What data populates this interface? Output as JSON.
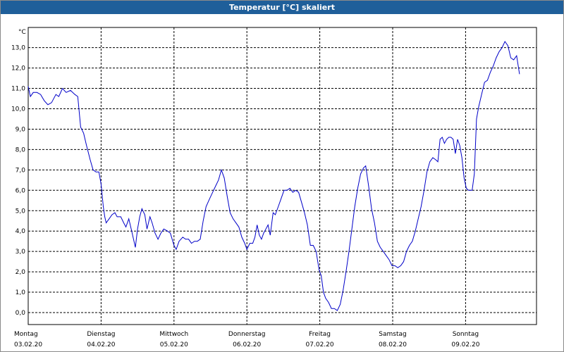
{
  "window": {
    "title": "Temperatur [°C] skaliert"
  },
  "colors": {
    "titlebar": "#1f5f9a",
    "series": "#0000c8",
    "grid": "#000000"
  },
  "chart_data": {
    "type": "line",
    "title": "Temperatur [°C] skaliert",
    "ylabel": "°C",
    "xlabel": "",
    "ylim": [
      -0.6,
      14.0
    ],
    "xlim": [
      0,
      7.0
    ],
    "grid": true,
    "legend": "none",
    "y_ticks": [
      "0,0",
      "1,0",
      "2,0",
      "3,0",
      "4,0",
      "5,0",
      "6,0",
      "7,0",
      "8,0",
      "9,0",
      "10,0",
      "11,0",
      "12,0",
      "13,0"
    ],
    "x_ticks": [
      {
        "day": "Montag",
        "date": "03.02.20"
      },
      {
        "day": "Dienstag",
        "date": "04.02.20"
      },
      {
        "day": "Mittwoch",
        "date": "05.02.20"
      },
      {
        "day": "Donnerstag",
        "date": "06.02.20"
      },
      {
        "day": "Freitag",
        "date": "07.02.20"
      },
      {
        "day": "Samstag",
        "date": "08.02.20"
      },
      {
        "day": "Sonntag",
        "date": "09.02.20"
      }
    ],
    "series": [
      {
        "points": [
          [
            0.0,
            11.1
          ],
          [
            0.03,
            10.6
          ],
          [
            0.07,
            10.8
          ],
          [
            0.12,
            10.8
          ],
          [
            0.17,
            10.7
          ],
          [
            0.22,
            10.4
          ],
          [
            0.27,
            10.2
          ],
          [
            0.32,
            10.3
          ],
          [
            0.38,
            10.7
          ],
          [
            0.42,
            10.6
          ],
          [
            0.47,
            11.0
          ],
          [
            0.52,
            10.8
          ],
          [
            0.58,
            10.9
          ],
          [
            0.64,
            10.7
          ],
          [
            0.68,
            10.6
          ],
          [
            0.72,
            9.1
          ],
          [
            0.76,
            8.8
          ],
          [
            0.8,
            8.2
          ],
          [
            0.85,
            7.5
          ],
          [
            0.89,
            7.0
          ],
          [
            0.93,
            6.9
          ],
          [
            0.97,
            6.9
          ],
          [
            1.0,
            6.3
          ],
          [
            1.03,
            5.2
          ],
          [
            1.05,
            4.7
          ],
          [
            1.07,
            4.4
          ],
          [
            1.11,
            4.6
          ],
          [
            1.15,
            4.8
          ],
          [
            1.19,
            4.9
          ],
          [
            1.22,
            4.7
          ],
          [
            1.27,
            4.7
          ],
          [
            1.31,
            4.4
          ],
          [
            1.34,
            4.2
          ],
          [
            1.38,
            4.6
          ],
          [
            1.42,
            4.0
          ],
          [
            1.47,
            3.2
          ],
          [
            1.5,
            4.1
          ],
          [
            1.53,
            4.7
          ],
          [
            1.56,
            5.1
          ],
          [
            1.6,
            4.8
          ],
          [
            1.63,
            4.1
          ],
          [
            1.67,
            4.7
          ],
          [
            1.7,
            4.4
          ],
          [
            1.74,
            3.9
          ],
          [
            1.78,
            3.6
          ],
          [
            1.82,
            3.9
          ],
          [
            1.86,
            4.1
          ],
          [
            1.91,
            4.0
          ],
          [
            1.95,
            3.9
          ],
          [
            2.0,
            3.3
          ],
          [
            2.03,
            3.1
          ],
          [
            2.07,
            3.5
          ],
          [
            2.12,
            3.7
          ],
          [
            2.16,
            3.6
          ],
          [
            2.2,
            3.6
          ],
          [
            2.24,
            3.4
          ],
          [
            2.28,
            3.5
          ],
          [
            2.32,
            3.5
          ],
          [
            2.36,
            3.6
          ],
          [
            2.4,
            4.5
          ],
          [
            2.44,
            5.2
          ],
          [
            2.49,
            5.6
          ],
          [
            2.53,
            5.9
          ],
          [
            2.57,
            6.2
          ],
          [
            2.61,
            6.5
          ],
          [
            2.65,
            7.0
          ],
          [
            2.69,
            6.6
          ],
          [
            2.73,
            5.7
          ],
          [
            2.77,
            4.9
          ],
          [
            2.81,
            4.6
          ],
          [
            2.85,
            4.4
          ],
          [
            2.89,
            4.2
          ],
          [
            2.93,
            3.7
          ],
          [
            2.97,
            3.4
          ],
          [
            3.0,
            3.1
          ],
          [
            3.04,
            3.4
          ],
          [
            3.08,
            3.4
          ],
          [
            3.11,
            3.7
          ],
          [
            3.14,
            4.3
          ],
          [
            3.17,
            3.8
          ],
          [
            3.2,
            3.6
          ],
          [
            3.23,
            3.9
          ],
          [
            3.26,
            4.1
          ],
          [
            3.29,
            4.3
          ],
          [
            3.32,
            3.8
          ],
          [
            3.36,
            4.9
          ],
          [
            3.39,
            4.8
          ],
          [
            3.43,
            5.2
          ],
          [
            3.47,
            5.6
          ],
          [
            3.51,
            6.0
          ],
          [
            3.55,
            6.0
          ],
          [
            3.59,
            6.1
          ],
          [
            3.63,
            5.9
          ],
          [
            3.67,
            6.0
          ],
          [
            3.71,
            5.9
          ],
          [
            3.75,
            5.4
          ],
          [
            3.79,
            4.9
          ],
          [
            3.83,
            4.3
          ],
          [
            3.87,
            3.3
          ],
          [
            3.91,
            3.3
          ],
          [
            3.95,
            3.0
          ],
          [
            3.99,
            2.1
          ],
          [
            4.02,
            1.8
          ],
          [
            4.05,
            1.0
          ],
          [
            4.08,
            0.7
          ],
          [
            4.12,
            0.5
          ],
          [
            4.16,
            0.2
          ],
          [
            4.2,
            0.2
          ],
          [
            4.24,
            0.1
          ],
          [
            4.28,
            0.4
          ],
          [
            4.32,
            1.1
          ],
          [
            4.36,
            2.0
          ],
          [
            4.4,
            3.0
          ],
          [
            4.44,
            4.1
          ],
          [
            4.48,
            5.2
          ],
          [
            4.52,
            6.1
          ],
          [
            4.56,
            6.8
          ],
          [
            4.6,
            7.1
          ],
          [
            4.63,
            7.2
          ],
          [
            4.67,
            6.2
          ],
          [
            4.71,
            5.1
          ],
          [
            4.75,
            4.4
          ],
          [
            4.79,
            3.5
          ],
          [
            4.83,
            3.2
          ],
          [
            4.87,
            3.0
          ],
          [
            4.91,
            2.8
          ],
          [
            4.95,
            2.6
          ],
          [
            4.99,
            2.3
          ],
          [
            5.03,
            2.3
          ],
          [
            5.07,
            2.2
          ],
          [
            5.11,
            2.3
          ],
          [
            5.15,
            2.5
          ],
          [
            5.19,
            3.0
          ],
          [
            5.23,
            3.3
          ],
          [
            5.27,
            3.5
          ],
          [
            5.31,
            4.0
          ],
          [
            5.35,
            4.6
          ],
          [
            5.39,
            5.2
          ],
          [
            5.43,
            6.0
          ],
          [
            5.47,
            6.9
          ],
          [
            5.51,
            7.4
          ],
          [
            5.55,
            7.6
          ],
          [
            5.59,
            7.5
          ],
          [
            5.62,
            7.4
          ],
          [
            5.65,
            8.5
          ],
          [
            5.68,
            8.6
          ],
          [
            5.71,
            8.3
          ],
          [
            5.74,
            8.5
          ],
          [
            5.77,
            8.6
          ],
          [
            5.8,
            8.6
          ],
          [
            5.83,
            8.5
          ],
          [
            5.86,
            7.8
          ],
          [
            5.89,
            8.5
          ],
          [
            5.92,
            8.2
          ],
          [
            5.95,
            7.6
          ],
          [
            5.98,
            6.6
          ],
          [
            6.01,
            6.1
          ],
          [
            6.04,
            6.0
          ],
          [
            6.07,
            6.0
          ],
          [
            6.09,
            6.0
          ],
          [
            6.12,
            6.8
          ],
          [
            6.15,
            9.5
          ],
          [
            6.18,
            10.1
          ],
          [
            6.22,
            10.7
          ],
          [
            6.26,
            11.3
          ],
          [
            6.3,
            11.4
          ],
          [
            6.34,
            11.8
          ],
          [
            6.38,
            12.1
          ],
          [
            6.42,
            12.5
          ],
          [
            6.46,
            12.8
          ],
          [
            6.5,
            13.0
          ],
          [
            6.54,
            13.3
          ],
          [
            6.58,
            13.1
          ],
          [
            6.62,
            12.5
          ],
          [
            6.66,
            12.4
          ],
          [
            6.7,
            12.6
          ],
          [
            6.74,
            11.7
          ]
        ]
      }
    ]
  }
}
